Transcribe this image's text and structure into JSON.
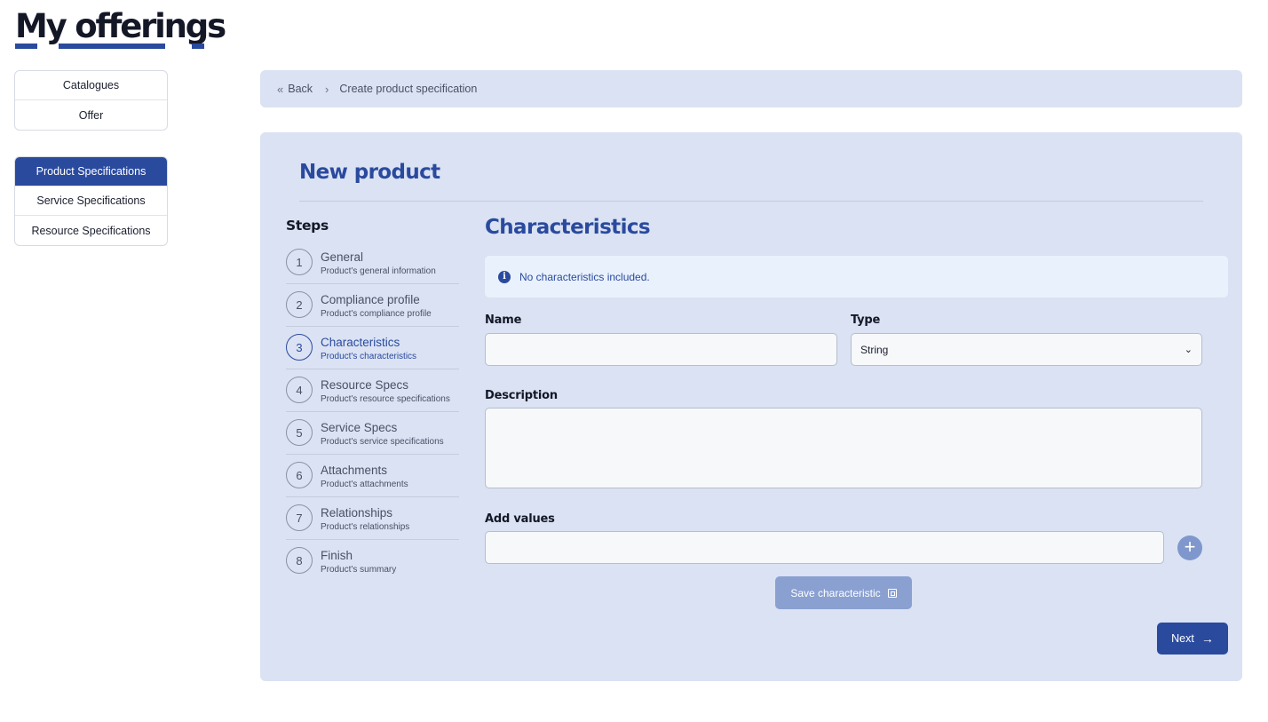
{
  "app": {
    "title": "My offerings"
  },
  "menus": {
    "top": [
      {
        "label": "Catalogues"
      },
      {
        "label": "Offer"
      }
    ],
    "specs": [
      {
        "label": "Product Specifications",
        "active": true
      },
      {
        "label": "Service Specifications"
      },
      {
        "label": "Resource Specifications"
      }
    ]
  },
  "breadcrumb": {
    "back_label": "Back",
    "current": "Create product specification"
  },
  "panel": {
    "title": "New product",
    "steps_title": "Steps",
    "steps": [
      {
        "number": "1",
        "name": "General",
        "subtitle": "Product's general information"
      },
      {
        "number": "2",
        "name": "Compliance profile",
        "subtitle": "Product's compliance profile"
      },
      {
        "number": "3",
        "name": "Characteristics",
        "subtitle": "Product's characteristics",
        "active": true
      },
      {
        "number": "4",
        "name": "Resource Specs",
        "subtitle": "Product's resource specifications"
      },
      {
        "number": "5",
        "name": "Service Specs",
        "subtitle": "Product's service specifications"
      },
      {
        "number": "6",
        "name": "Attachments",
        "subtitle": "Product's attachments"
      },
      {
        "number": "7",
        "name": "Relationships",
        "subtitle": "Product's relationships"
      },
      {
        "number": "8",
        "name": "Finish",
        "subtitle": "Product's summary"
      }
    ]
  },
  "form": {
    "section_title": "Characteristics",
    "info_message": "No characteristics included.",
    "name_label": "Name",
    "name_value": "",
    "type_label": "Type",
    "type_value": "String",
    "description_label": "Description",
    "description_value": "",
    "add_values_label": "Add values",
    "add_values_value": "",
    "save_label": "Save characteristic",
    "next_label": "Next"
  },
  "colors": {
    "accent": "#2a4a9e",
    "panel_bg": "#dae2f3",
    "info_bg": "#e9f1fc"
  }
}
